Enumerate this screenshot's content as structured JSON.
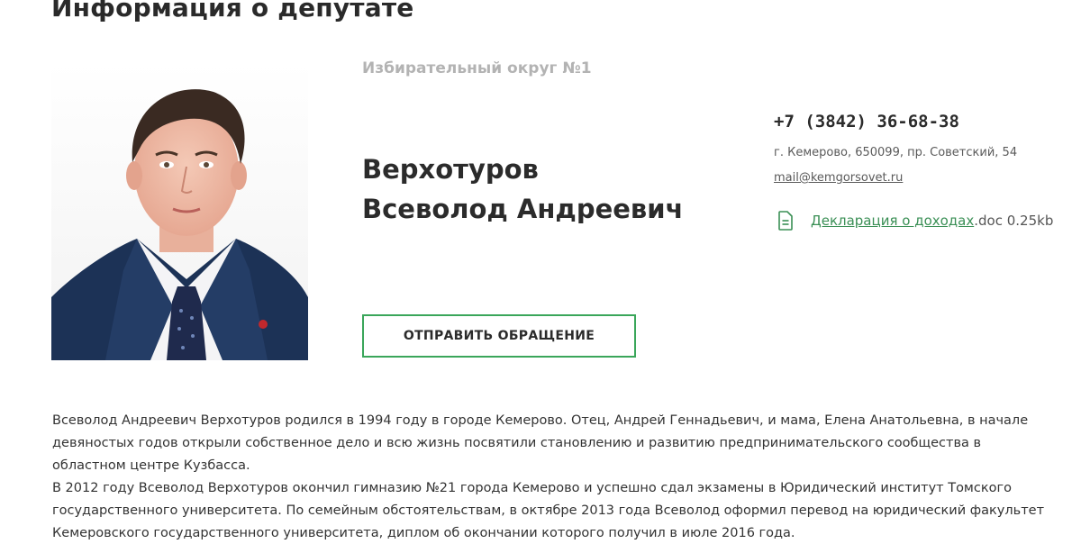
{
  "page": {
    "title": "Информация о депутате"
  },
  "deputy": {
    "district": "Избирательный округ №1",
    "surname": "Верхотуров",
    "given_names": "Всеволод Андреевич",
    "appeal_button": "ОТПРАВИТЬ ОБРАЩЕНИЕ",
    "photo_icon": "portrait-photo"
  },
  "contacts": {
    "phone": "+7 (3842) 36-68-38",
    "address": "г. Кемерово, 650099, пр. Советский, 54",
    "email": "mail@kemgorsovet.ru"
  },
  "declaration": {
    "icon": "document-icon",
    "link_text": "Декларация о доходах",
    "meta": ".doc 0.25kb"
  },
  "bio": {
    "paragraph_1": "Всеволод Андреевич Верхотуров родился в 1994 году в городе Кемерово. Отец, Андрей Геннадьевич, и мама, Елена Анатольевна, в начале девяностых годов открыли собственное дело и всю жизнь посвятили становлению и развитию предпринимательского сообщества в областном центре Кузбасса.",
    "paragraph_2": "В 2012 году Всеволод Верхотуров окончил гимназию №21 города Кемерово и успешно сдал экзамены в Юридический институт Томского государственного университета. По семейным обстоятельствам, в октябре 2013 года Всеволод оформил перевод на юридический факультет Кемеровского государственного университета, диплом об окончании которого получил в июле 2016 года."
  },
  "colors": {
    "accent_green": "#3aa65a",
    "link_green": "#3a8f55",
    "muted_gray": "#b3b3b3"
  }
}
